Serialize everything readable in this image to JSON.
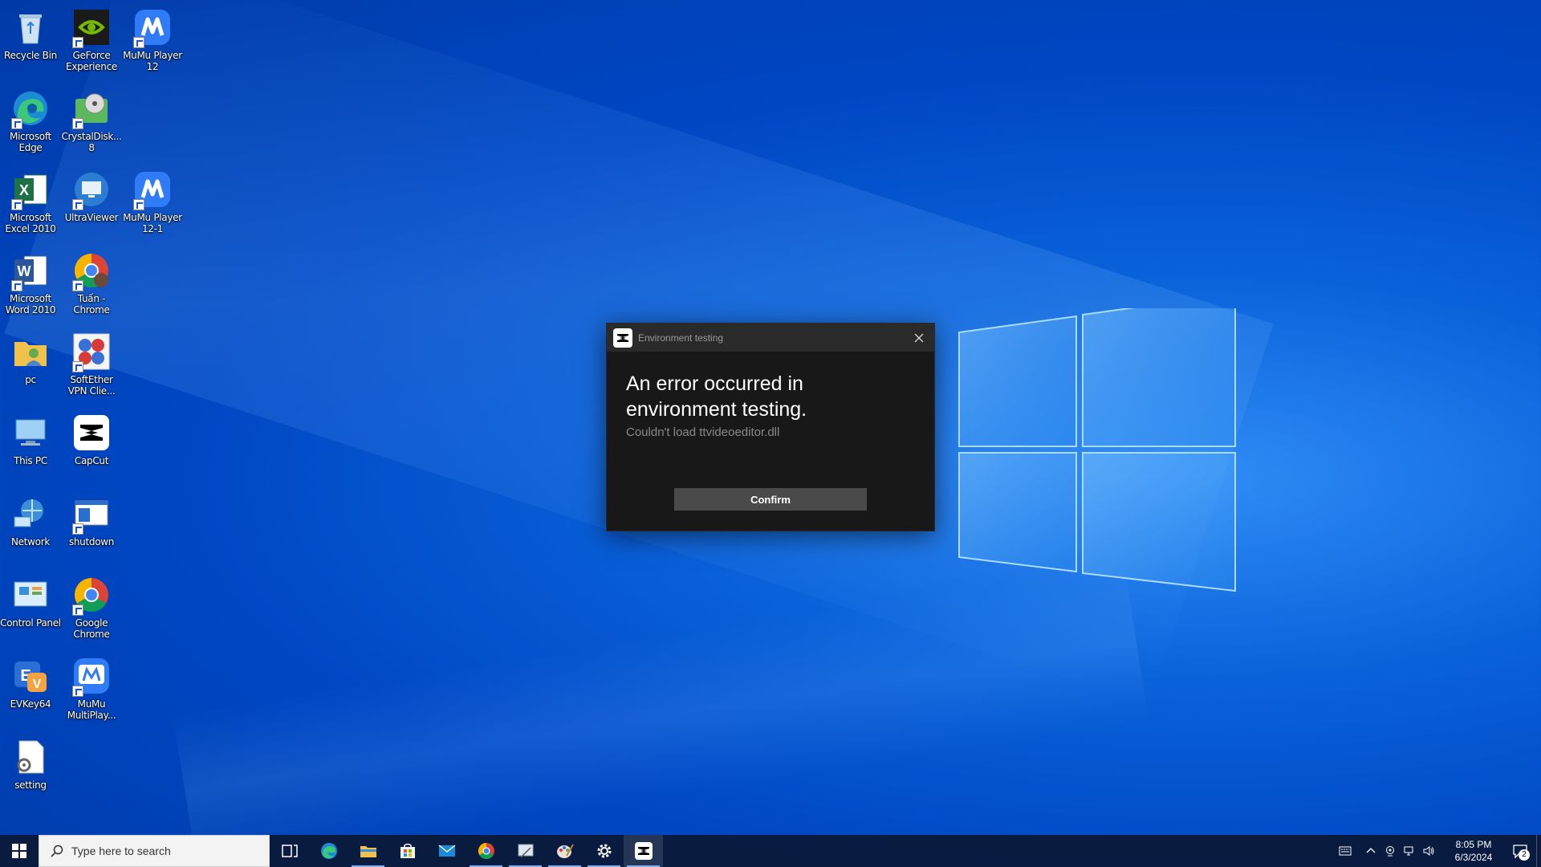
{
  "desktop": {
    "icons": [
      {
        "label": "Recycle Bin",
        "icon": "recycle-bin-icon"
      },
      {
        "label": "GeForce Experience",
        "icon": "geforce-icon"
      },
      {
        "label": "MuMu Player 12",
        "icon": "mumu-icon"
      },
      {
        "label": "Microsoft Edge",
        "icon": "edge-icon"
      },
      {
        "label": "CrystalDisk... 8",
        "icon": "crystaldisk-icon"
      },
      {
        "label": "Microsoft Excel 2010",
        "icon": "excel-icon"
      },
      {
        "label": "UltraViewer",
        "icon": "ultraviewer-icon"
      },
      {
        "label": "MuMu Player 12-1",
        "icon": "mumu-icon"
      },
      {
        "label": "Microsoft Word 2010",
        "icon": "word-icon"
      },
      {
        "label": "Tuấn - Chrome",
        "icon": "chrome-profile-icon"
      },
      {
        "label": "pc",
        "icon": "folder-user-icon"
      },
      {
        "label": "SoftEther VPN Clie...",
        "icon": "softether-icon"
      },
      {
        "label": "This PC",
        "icon": "this-pc-icon"
      },
      {
        "label": "CapCut",
        "icon": "capcut-icon"
      },
      {
        "label": "Network",
        "icon": "network-icon"
      },
      {
        "label": "shutdown",
        "icon": "shutdown-shortcut-icon"
      },
      {
        "label": "Control Panel",
        "icon": "control-panel-icon"
      },
      {
        "label": "Google Chrome",
        "icon": "chrome-icon"
      },
      {
        "label": "EVKey64",
        "icon": "evkey-icon"
      },
      {
        "label": "MuMu MultiPlay...",
        "icon": "mumu-multi-icon"
      },
      {
        "label": "setting",
        "icon": "settings-file-icon"
      }
    ]
  },
  "dialog": {
    "title": "Environment testing",
    "heading": "An error occurred in environment testing.",
    "detail": "Couldn't load ttvideoeditor.dll",
    "confirm_label": "Confirm"
  },
  "taskbar": {
    "search_placeholder": "Type here to search",
    "apps": [
      "task-view-icon",
      "edge-icon",
      "file-explorer-icon",
      "store-icon",
      "mail-icon",
      "chrome-icon",
      "snipping-icon",
      "paint-icon",
      "settings-icon",
      "capcut-icon"
    ],
    "clock_time": "8:05 PM",
    "clock_date": "6/3/2024",
    "notification_count": "2"
  },
  "colors": {
    "desktop_blue": "#0a62da",
    "dialog_bg": "#181818",
    "dialog_title_bg": "#2a2a2a",
    "button_bg": "#4a4a4a",
    "taskbar_bg": "#0a1834"
  }
}
